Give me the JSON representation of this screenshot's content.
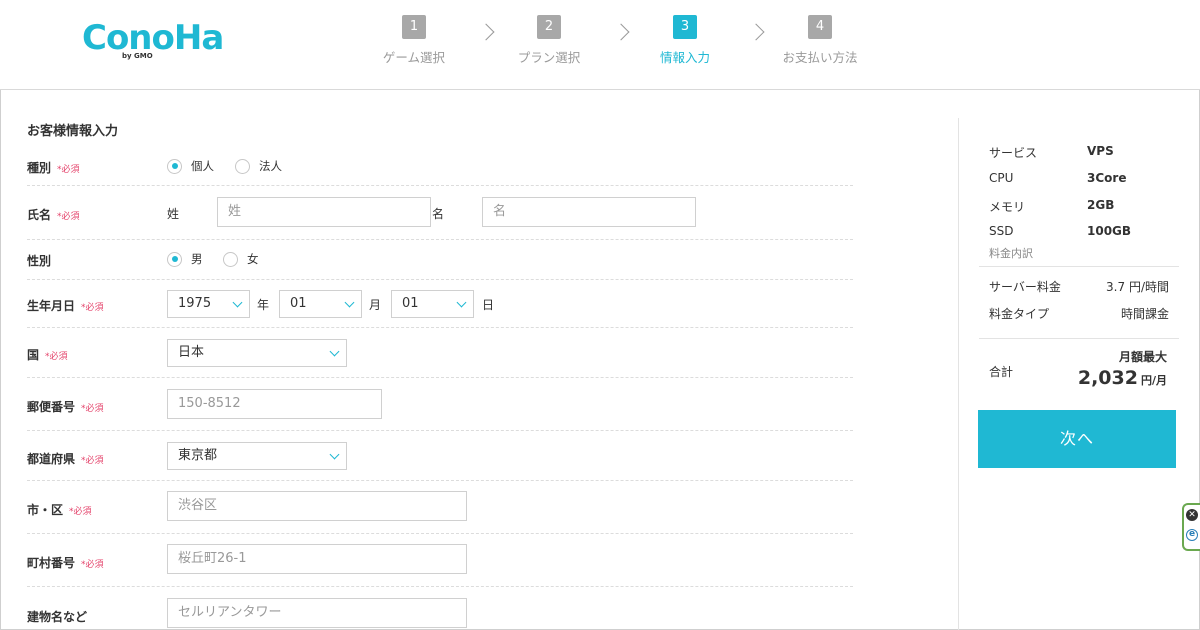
{
  "brand": {
    "logo_text": "ConoHa",
    "logo_sub": "by GMO",
    "color": "#1fb8d3"
  },
  "steps": [
    {
      "num": "1",
      "label": "ゲーム選択",
      "active": false
    },
    {
      "num": "2",
      "label": "プラン選択",
      "active": false
    },
    {
      "num": "3",
      "label": "情報入力",
      "active": true
    },
    {
      "num": "4",
      "label": "お支払い方法",
      "active": false
    }
  ],
  "form": {
    "title": "お客様情報入力",
    "required_mark": "*必須",
    "type": {
      "label": "種別",
      "options": [
        "個人",
        "法人"
      ],
      "selected": "個人"
    },
    "name": {
      "label": "氏名",
      "last_label": "姓",
      "last_placeholder": "姓",
      "first_label": "名",
      "first_placeholder": "名"
    },
    "gender": {
      "label": "性別",
      "options": [
        "男",
        "女"
      ],
      "selected": "男"
    },
    "birthdate": {
      "label": "生年月日",
      "year": "1975",
      "year_unit": "年",
      "month": "01",
      "month_unit": "月",
      "day": "01",
      "day_unit": "日"
    },
    "country": {
      "label": "国",
      "value": "日本"
    },
    "postal": {
      "label": "郵便番号",
      "placeholder": "150-8512"
    },
    "prefecture": {
      "label": "都道府県",
      "value": "東京都"
    },
    "city": {
      "label": "市・区",
      "placeholder": "渋谷区"
    },
    "address": {
      "label": "町村番号",
      "placeholder": "桜丘町26-1"
    },
    "building": {
      "label": "建物名など",
      "placeholder": "セルリアンタワー"
    }
  },
  "summary": {
    "specs": [
      {
        "key": "サービス",
        "value": "VPS"
      },
      {
        "key": "CPU",
        "value": "3Core"
      },
      {
        "key": "メモリ",
        "value": "2GB"
      },
      {
        "key": "SSD",
        "value": "100GB"
      }
    ],
    "breakdown_label": "料金内訳",
    "fees": [
      {
        "key": "サーバー料金",
        "value": "3.7 円/時間"
      },
      {
        "key": "料金タイプ",
        "value": "時間課金"
      }
    ],
    "total_label": "合計",
    "total_caption": "月額最大",
    "total_amount": "2,032",
    "total_unit": "円/月",
    "next_button": "次へ"
  },
  "edge_widget": {
    "close_icon": "x-circle-icon",
    "e_icon": "e-circle-icon",
    "close_glyph": "✕",
    "e_glyph": "e"
  }
}
